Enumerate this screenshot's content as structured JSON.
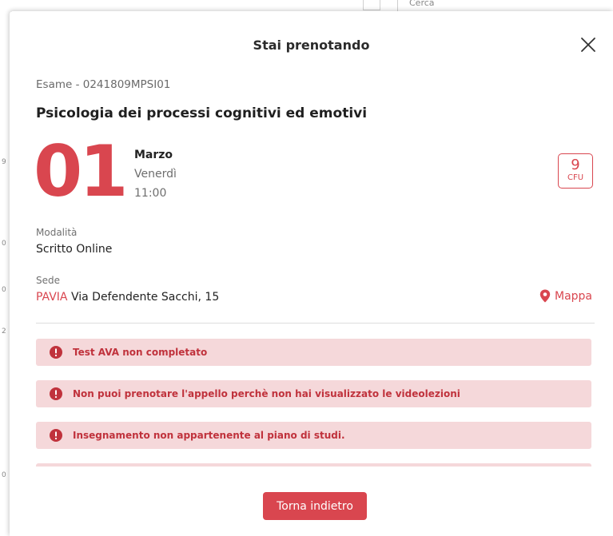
{
  "background": {
    "search_label": "Cerca"
  },
  "modal": {
    "title": "Stai prenotando",
    "close_icon": "close-icon"
  },
  "exam": {
    "code": "Esame - 0241809MPSI01",
    "name": "Psicologia dei processi cognitivi ed emotivi",
    "day": "01",
    "month": "Marzo",
    "weekday": "Venerdì",
    "time": "11:00",
    "cfu_value": "9",
    "cfu_label": "CFU"
  },
  "details": {
    "modalita_label": "Modalità",
    "modalita_value": "Scritto Online",
    "sede_label": "Sede",
    "sede_city": "PAVIA",
    "sede_address": "Via Defendente Sacchi, 15",
    "map_label": "Mappa",
    "map_icon": "map-pin-icon"
  },
  "alerts": [
    {
      "icon": "alert-circle-icon",
      "text": "Test AVA non completato"
    },
    {
      "icon": "alert-circle-icon",
      "text": "Non puoi prenotare l'appello perchè non hai visualizzato le videolezioni"
    },
    {
      "icon": "alert-circle-icon",
      "text": "Insegnamento non appartenente al piano di studi."
    }
  ],
  "footer": {
    "back_label": "Torna indietro"
  },
  "colors": {
    "accent": "#d9464f",
    "alert_bg": "#f5d8da",
    "alert_text": "#c0323c"
  }
}
